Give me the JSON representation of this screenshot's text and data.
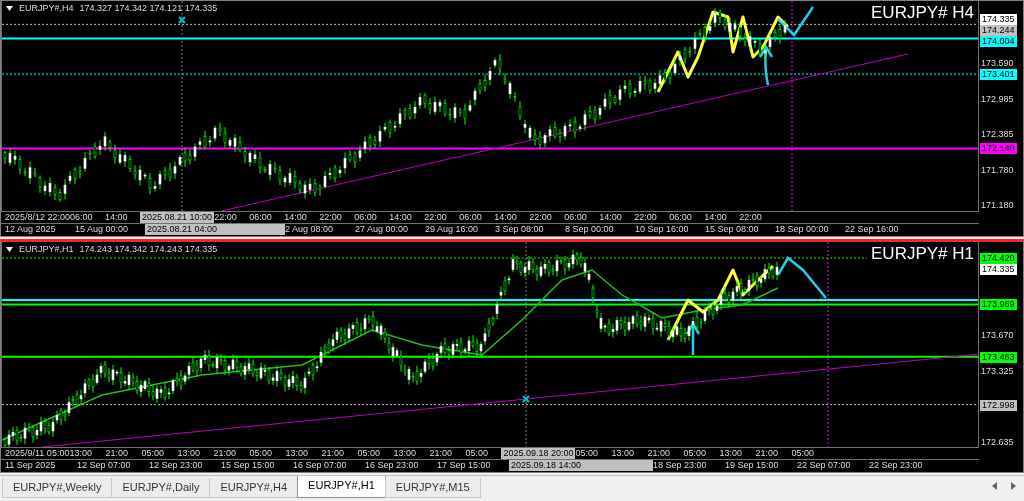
{
  "charts": [
    {
      "header": {
        "symbol": "EURJPY#,H4",
        "quote": "174.327 174.342 174.121 174.335"
      },
      "title": "EURJPY# H4",
      "active": false,
      "price_axis": [
        {
          "kind": "price",
          "text": "174.335",
          "color": "#ffffff"
        },
        {
          "kind": "level",
          "text": "174.244",
          "color": "#c0c0c0",
          "dashed": true
        },
        {
          "kind": "level",
          "text": "174.004",
          "color": "#00ffff",
          "dashed": false
        },
        {
          "kind": "tick",
          "text": "173.590"
        },
        {
          "kind": "level",
          "text": "173.401",
          "color": "#00ffff",
          "dashed": true
        },
        {
          "kind": "tick",
          "text": "172.985"
        },
        {
          "kind": "tick",
          "text": "172.385"
        },
        {
          "kind": "level",
          "text": "172.140",
          "color": "#ff00ff",
          "dashed": false
        },
        {
          "kind": "tick",
          "text": "171.780"
        },
        {
          "kind": "tick",
          "text": "171.180"
        }
      ],
      "time_axis": {
        "upper": [
          {
            "kind": "tick",
            "text": "2025/8/12 22:00"
          },
          {
            "kind": "tick",
            "text": "06:00"
          },
          {
            "kind": "tick",
            "text": "14:00"
          },
          {
            "kind": "cursor",
            "text": "2025.08.21 10:00"
          },
          {
            "kind": "tick",
            "text": "22:00"
          },
          {
            "kind": "tick",
            "text": "06:00"
          },
          {
            "kind": "tick",
            "text": "14:00"
          },
          {
            "kind": "tick",
            "text": "22:00"
          },
          {
            "kind": "tick",
            "text": "06:00"
          },
          {
            "kind": "tick",
            "text": "14:00"
          },
          {
            "kind": "tick",
            "text": "22:00"
          },
          {
            "kind": "tick",
            "text": "06:00"
          },
          {
            "kind": "tick",
            "text": "14:00"
          },
          {
            "kind": "tick",
            "text": "22:00"
          },
          {
            "kind": "tick",
            "text": "06:00"
          },
          {
            "kind": "tick",
            "text": "14:00"
          },
          {
            "kind": "tick",
            "text": "22:00"
          },
          {
            "kind": "tick",
            "text": "06:00"
          },
          {
            "kind": "tick",
            "text": "14:00"
          },
          {
            "kind": "tick",
            "text": "22:00"
          }
        ],
        "lower": [
          {
            "kind": "tick",
            "text": "12 Aug 2025"
          },
          {
            "kind": "tick",
            "text": "15 Aug 00:00"
          },
          {
            "kind": "cursor",
            "text": "2025.08.21 04:00"
          },
          {
            "kind": "tick",
            "text": "2 Aug 08:00"
          },
          {
            "kind": "tick",
            "text": "27 Aug 00:00"
          },
          {
            "kind": "tick",
            "text": "29 Aug 16:00"
          },
          {
            "kind": "tick",
            "text": "3 Sep 08:00"
          },
          {
            "kind": "tick",
            "text": "8 Sep 00:00"
          },
          {
            "kind": "tick",
            "text": "10 Sep 16:00"
          },
          {
            "kind": "tick",
            "text": "15 Sep 08:00"
          },
          {
            "kind": "tick",
            "text": "18 Sep 00:00"
          },
          {
            "kind": "tick",
            "text": "22 Sep 16:00"
          }
        ]
      }
    },
    {
      "header": {
        "symbol": "EURJPY#,H1",
        "quote": "174.243 174.342 174.243 174.335"
      },
      "title": "EURJPY# H1",
      "active": true,
      "price_axis": [
        {
          "kind": "level",
          "text": "174.420",
          "color": "#00ff00",
          "dashed": true
        },
        {
          "kind": "price",
          "text": "174.335",
          "color": "#ffffff"
        },
        {
          "kind": "level",
          "text": "173.969",
          "color": "#00ff00",
          "dashed": false
        },
        {
          "kind": "tick",
          "text": "173.670"
        },
        {
          "kind": "level",
          "text": "173.463",
          "color": "#00ff00",
          "dashed": false
        },
        {
          "kind": "tick",
          "text": "173.325"
        },
        {
          "kind": "level",
          "text": "172.998",
          "color": "#c0c0c0",
          "dashed": true
        },
        {
          "kind": "tick",
          "text": "172.635"
        }
      ],
      "time_axis": {
        "upper": [
          {
            "kind": "tick",
            "text": "2025/9/11 05:00"
          },
          {
            "kind": "tick",
            "text": "13:00"
          },
          {
            "kind": "tick",
            "text": "21:00"
          },
          {
            "kind": "tick",
            "text": "05:00"
          },
          {
            "kind": "tick",
            "text": "13:00"
          },
          {
            "kind": "tick",
            "text": "21:00"
          },
          {
            "kind": "tick",
            "text": "05:00"
          },
          {
            "kind": "tick",
            "text": "13:00"
          },
          {
            "kind": "tick",
            "text": "21:00"
          },
          {
            "kind": "tick",
            "text": "05:00"
          },
          {
            "kind": "tick",
            "text": "13:00"
          },
          {
            "kind": "tick",
            "text": "21:00"
          },
          {
            "kind": "tick",
            "text": "05:00"
          },
          {
            "kind": "cursor",
            "text": "2025.09.18 20:00"
          },
          {
            "kind": "tick",
            "text": "05:00"
          },
          {
            "kind": "tick",
            "text": "13:00"
          },
          {
            "kind": "tick",
            "text": "21:00"
          },
          {
            "kind": "tick",
            "text": "05:00"
          },
          {
            "kind": "tick",
            "text": "13:00"
          },
          {
            "kind": "tick",
            "text": "21:00"
          },
          {
            "kind": "tick",
            "text": "05:00"
          }
        ],
        "lower": [
          {
            "kind": "tick",
            "text": "11 Sep 2025"
          },
          {
            "kind": "tick",
            "text": "12 Sep 07:00"
          },
          {
            "kind": "tick",
            "text": "12 Sep 23:00"
          },
          {
            "kind": "tick",
            "text": "15 Sep 15:00"
          },
          {
            "kind": "tick",
            "text": "16 Sep 07:00"
          },
          {
            "kind": "tick",
            "text": "16 Sep 23:00"
          },
          {
            "kind": "tick",
            "text": "17 Sep 15:00"
          },
          {
            "kind": "cursor",
            "text": "2025.09.18 14:00"
          },
          {
            "kind": "tick",
            "text": "18 Sep 23:00"
          },
          {
            "kind": "tick",
            "text": "19 Sep 15:00"
          },
          {
            "kind": "tick",
            "text": "22 Sep 07:00"
          },
          {
            "kind": "tick",
            "text": "22 Sep 23:00"
          }
        ]
      }
    }
  ],
  "tabs": [
    {
      "label": "EURJPY#,Weekly",
      "selected": false
    },
    {
      "label": "EURJPY#,Daily",
      "selected": false
    },
    {
      "label": "EURJPY#,H4",
      "selected": false
    },
    {
      "label": "EURJPY#,H1",
      "selected": true
    },
    {
      "label": "EURJPY#,M15",
      "selected": false
    }
  ]
}
